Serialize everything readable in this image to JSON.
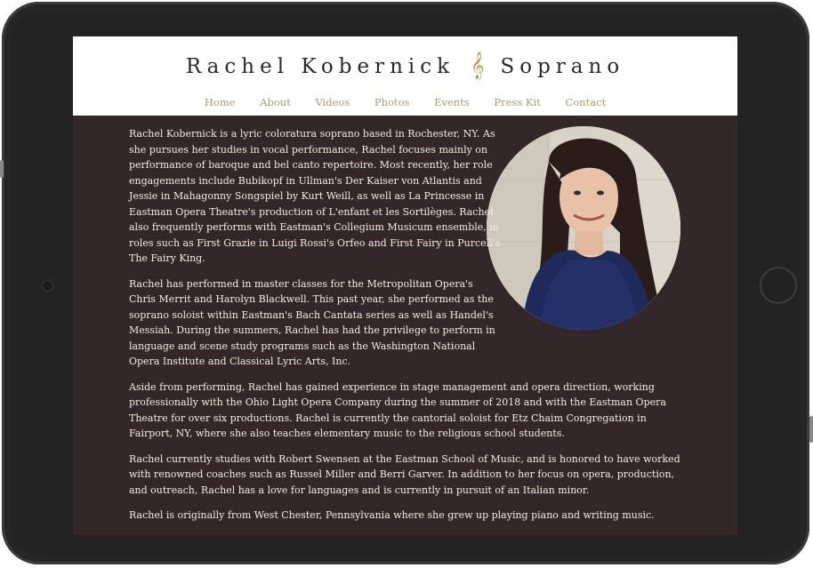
{
  "site": {
    "name_left": "Rachel Kobernick",
    "name_right": "Soprano",
    "clef_symbol": "𝄞"
  },
  "nav": {
    "items": [
      "Home",
      "About",
      "Videos",
      "Photos",
      "Events",
      "Press Kit",
      "Contact"
    ]
  },
  "bio": {
    "p1": "Rachel Kobernick is a lyric coloratura soprano based in Rochester, NY. As she pursues her studies in vocal performance, Rachel focuses mainly on performance of baroque and bel canto repertoire. Most recently, her role engagements include Bubikopf in Ullman's Der Kaiser von Atlantis and Jessie in Mahagonny Songspiel by Kurt Weill, as well as La Princesse in Eastman Opera Theatre's production of L'enfant et les Sortilèges. Rachel also frequently performs with Eastman's Collegium Musicum ensemble, in roles such as First Grazie in Luigi Rossi's Orfeo and First Fairy in Purcell's The Fairy King.",
    "p2": "Rachel has performed in master classes for the Metropolitan Opera's Chris Merrit and Harolyn Blackwell. This past year, she performed as the soprano soloist within Eastman's Bach Cantata series as well as Handel's Messiah. During the summers, Rachel has had the privilege to perform in language and scene study programs such as the Washington National Opera Institute and Classical Lyric Arts, Inc.",
    "p3": "Aside from performing, Rachel has gained experience in stage management and opera direction, working professionally with the Ohio Light Opera Company during the summer of 2018 and with the Eastman Opera Theatre for over six productions. Rachel is currently the cantorial soloist for Etz Chaim Congregation in Fairport, NY, where she also teaches elementary music to the religious school students.",
    "p4": "Rachel currently studies with Robert Swensen at the Eastman School of Music, and is honored to have worked with renowned coaches such as Russel Miller and Berri Garver. In addition to her focus on opera, production, and outreach, Rachel has a love for languages and is currently in pursuit of an Italian minor.",
    "p5": "Rachel is originally from West Chester, Pennsylvania where she grew up playing piano and writing music."
  },
  "colors": {
    "background": "#342729",
    "nav_link": "#a99a6e",
    "clef": "#b09a62",
    "body_text": "#f2ece4"
  }
}
